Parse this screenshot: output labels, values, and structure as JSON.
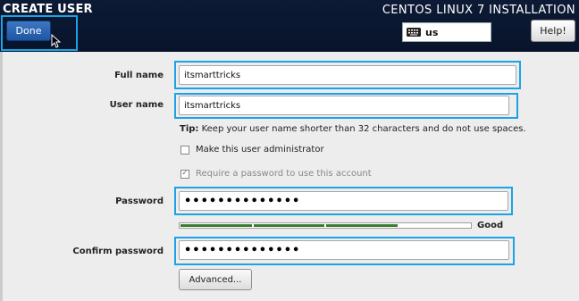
{
  "header": {
    "page_title": "CREATE USER",
    "install_title": "CENTOS LINUX 7 INSTALLATION",
    "done_label": "Done",
    "keyboard_layout": "us",
    "help_label": "Help!"
  },
  "form": {
    "full_name": {
      "label": "Full name",
      "value": "itsmarttricks"
    },
    "user_name": {
      "label": "User name",
      "value": "itsmarttricks"
    },
    "tip_prefix": "Tip:",
    "tip_text": " Keep your user name shorter than 32 characters and do not use spaces.",
    "admin_checkbox": {
      "label": "Make this user administrator",
      "checked": false
    },
    "require_password_checkbox": {
      "label": "Require a password to use this account",
      "checked": true
    },
    "password": {
      "label": "Password",
      "value": "••••••••••••••"
    },
    "strength": {
      "label": "Good",
      "level": 0.75
    },
    "confirm_password": {
      "label": "Confirm password",
      "value": "••••••••••••••"
    },
    "advanced_label": "Advanced..."
  },
  "colors": {
    "header_bg": "#0c1a35",
    "accent_highlight": "#1aa3e6",
    "done_button": "#2a63b0",
    "strength_fill": "#3d7a32"
  },
  "icons": {
    "keyboard": "keyboard-icon",
    "cursor": "mouse-pointer-icon",
    "check": "check-icon"
  }
}
